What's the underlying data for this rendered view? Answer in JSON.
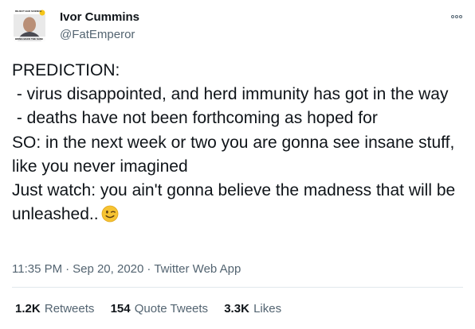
{
  "author": {
    "display_name": "Ivor Cummins",
    "handle": "@FatEmperor",
    "avatar_banner_top": "REJECT BAD SCIENCE",
    "avatar_banner_bottom": "BRING BACK THE SANE"
  },
  "tweet": {
    "lines": [
      "PREDICTION:",
      " - virus disappointed, and herd immunity has got in the way",
      " - deaths have not been forthcoming as hoped for",
      "SO: in the next week or two you are gonna see insane stuff, like you never imagined",
      "Just watch: you ain't gonna believe the madness that will be unleashed.."
    ],
    "emoji": "winking-face-emoji",
    "time": "11:35 PM",
    "date": "Sep 20, 2020",
    "separator": "·",
    "source": "Twitter Web App"
  },
  "stats": {
    "retweets_count": "1.2K",
    "retweets_label": "Retweets",
    "quote_count": "154",
    "quote_label": "Quote Tweets",
    "likes_count": "3.3K",
    "likes_label": "Likes"
  },
  "colors": {
    "text_primary": "#0f1419",
    "text_secondary": "#536471",
    "divider": "#e1e8ed"
  }
}
